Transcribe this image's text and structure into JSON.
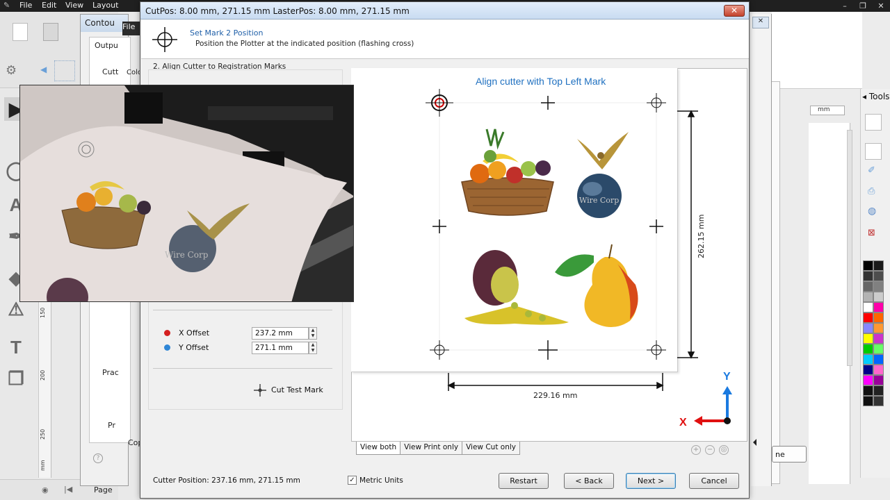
{
  "app": {
    "menu": [
      "File",
      "Edit",
      "View",
      "Layout"
    ],
    "window_controls": [
      "–",
      "❐",
      "✕"
    ]
  },
  "ruler": {
    "ticks": [
      "150",
      "200",
      "250",
      "mm"
    ]
  },
  "contour_dialog": {
    "title": "Contou",
    "fragments": [
      "File",
      "Outpu",
      "Cutt",
      "Colo",
      "Prac",
      "Pr",
      "Cop"
    ]
  },
  "right_area": {
    "tools_label": "Tools",
    "ruler_unit": "mm",
    "partial_button": "ne"
  },
  "wizard": {
    "title": "CutPos: 8.00 mm, 271.15 mm  LasterPos: 8.00 mm, 271.15 mm",
    "close_glyph": "✕",
    "header_title": "Set Mark 2 Position",
    "header_subtitle": "Position the Plotter at the indicated position (flashing cross)",
    "step_label": "2. Align Cutter to Registration Marks",
    "x_offset": {
      "label": "X Offset",
      "value": "237.2 mm",
      "color": "#d42020"
    },
    "y_offset": {
      "label": "Y Offset",
      "value": "271.1 mm",
      "color": "#2f86d6"
    },
    "cut_test_label": "Cut Test Mark",
    "preview": {
      "title": "Align cutter with Top Left Mark",
      "width_label": "229.16 mm",
      "height_label": "262.15 mm",
      "axis_x": "X",
      "axis_y": "Y",
      "logo_text": "Wire Corp"
    },
    "view_tabs": [
      "View both",
      "View Print only",
      "View Cut only"
    ],
    "zoom_icons": [
      "zoom-in-icon",
      "zoom-out-icon",
      "zoom-fit-icon"
    ],
    "status": "Cutter Position: 237.16 mm, 271.15 mm",
    "metric_units_label": "Metric Units",
    "metric_units_checked": "✓",
    "buttons": {
      "restart": "Restart",
      "back": "< Back",
      "next": "Next >",
      "cancel": "Cancel"
    }
  },
  "video_overlay": {
    "logo_text": "Wire Corp"
  },
  "colors": {
    "accent_blue": "#1f70c0",
    "x_axis_red": "#e01010",
    "y_axis_blue": "#1a7ae0"
  }
}
